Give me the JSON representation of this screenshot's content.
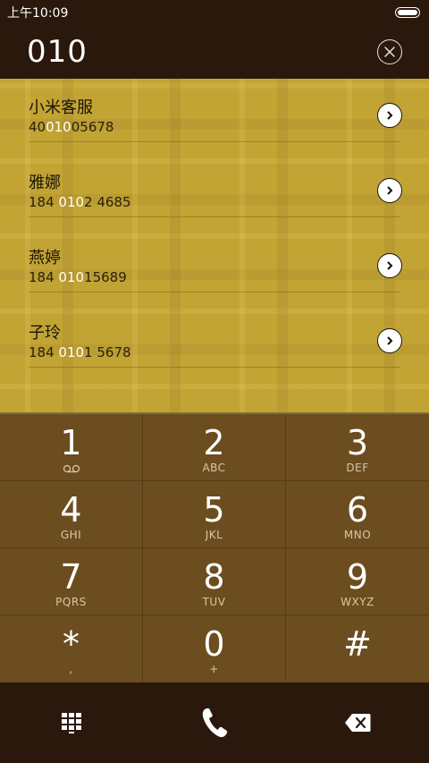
{
  "status": {
    "time": "上午10:09"
  },
  "header": {
    "query": "010"
  },
  "contacts": [
    {
      "name": "小米客服",
      "num_pre": "40",
      "num_hl": "010",
      "num_post": "05678"
    },
    {
      "name": "雅娜",
      "num_pre": "184 ",
      "num_hl": "010",
      "num_post": "2 4685"
    },
    {
      "name": "燕婷",
      "num_pre": "184 ",
      "num_hl": "010",
      "num_post": "15689"
    },
    {
      "name": "子玲",
      "num_pre": "184 ",
      "num_hl": "010",
      "num_post": "1 5678"
    }
  ],
  "keys": [
    {
      "digit": "1",
      "letters": ""
    },
    {
      "digit": "2",
      "letters": "ABC"
    },
    {
      "digit": "3",
      "letters": "DEF"
    },
    {
      "digit": "4",
      "letters": "GHI"
    },
    {
      "digit": "5",
      "letters": "JKL"
    },
    {
      "digit": "6",
      "letters": "MNO"
    },
    {
      "digit": "7",
      "letters": "PQRS"
    },
    {
      "digit": "8",
      "letters": "TUV"
    },
    {
      "digit": "9",
      "letters": "WXYZ"
    },
    {
      "digit": "*",
      "letters": ","
    },
    {
      "digit": "0",
      "letters": "+"
    },
    {
      "digit": "#",
      "letters": ""
    }
  ],
  "icons": {
    "clear": "close-circle-icon",
    "detail": "chevron-right-icon",
    "voicemail": "voicemail-icon",
    "dialpad": "dialpad-grid-icon",
    "call": "phone-icon",
    "delete": "backspace-icon"
  }
}
